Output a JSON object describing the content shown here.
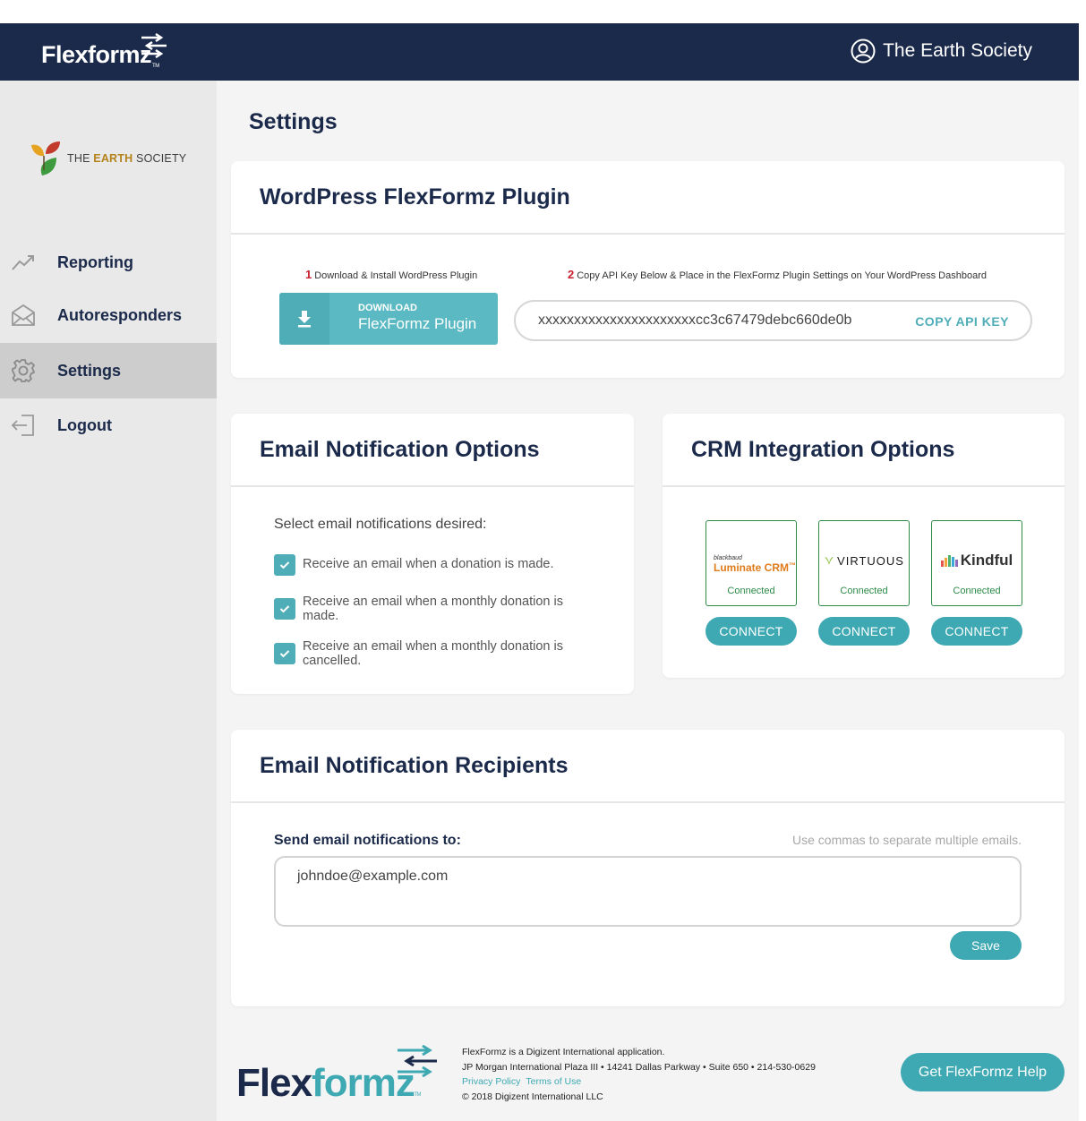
{
  "header": {
    "brand": "Flexformz",
    "brand_tm": "TM",
    "account_name": "The Earth Society"
  },
  "sidebar": {
    "org_logo": {
      "prefix": "THE",
      "highlight": "EARTH",
      "suffix": "SOCIETY"
    },
    "items": [
      {
        "label": "Reporting",
        "icon": "trend-icon"
      },
      {
        "label": "Autoresponders",
        "icon": "envelope-icon"
      },
      {
        "label": "Settings",
        "icon": "gear-icon",
        "active": true
      },
      {
        "label": "Logout",
        "icon": "logout-icon"
      }
    ]
  },
  "page": {
    "title": "Settings"
  },
  "plugin_card": {
    "title": "WordPress FlexFormz Plugin",
    "step1_num": "1",
    "step1_text": "Download & Install WordPress Plugin",
    "step2_num": "2",
    "step2_text": "Copy API Key Below & Place in the FlexFormz Plugin Settings on Your WordPress Dashboard",
    "download_small": "DOWNLOAD",
    "download_big": "FlexFormz Plugin",
    "api_key": "xxxxxxxxxxxxxxxxxxxxxxcc3c67479debc660de0b",
    "copy_label": "COPY API KEY"
  },
  "email_options": {
    "title": "Email Notification Options",
    "intro": "Select email notifications desired:",
    "options": [
      {
        "label": "Receive an email when a donation is made.",
        "checked": true
      },
      {
        "label": "Receive an email when a monthly donation is made.",
        "checked": true
      },
      {
        "label": "Receive an email when a monthly donation is cancelled.",
        "checked": true
      }
    ]
  },
  "crm": {
    "title": "CRM Integration Options",
    "integrations": [
      {
        "logo_small": "blackbaud",
        "logo": "Luminate CRM",
        "logo_tm": "™",
        "status": "Connected",
        "button": "CONNECT"
      },
      {
        "logo": "VIRTUOUS",
        "status": "Connected",
        "button": "CONNECT"
      },
      {
        "logo": "Kindful",
        "status": "Connected",
        "button": "CONNECT"
      }
    ]
  },
  "recipients": {
    "title": "Email Notification Recipients",
    "label": "Send email notifications to:",
    "hint": "Use commas to separate multiple emails.",
    "value": "johndoe@example.com",
    "save": "Save"
  },
  "footer": {
    "logo_a": "Flex",
    "logo_b": "formz",
    "logo_tm": "TM",
    "line1": "FlexFormz is a Digizent International application.",
    "line2": "JP Morgan International Plaza III • 14241 Dallas Parkway • Suite 650 • 214-530-0629",
    "privacy": "Privacy Policy",
    "terms": "Terms of Use",
    "copyright": "© 2018 Digizent International LLC",
    "help": "Get FlexFormz Help"
  },
  "colors": {
    "navy": "#1b2a4a",
    "teal": "#3ea9b3",
    "sidebar_bg": "#e9e9e9",
    "active_bg": "#cdcdcd",
    "connected_green": "#2d8a47",
    "step_red": "#c8202f"
  }
}
